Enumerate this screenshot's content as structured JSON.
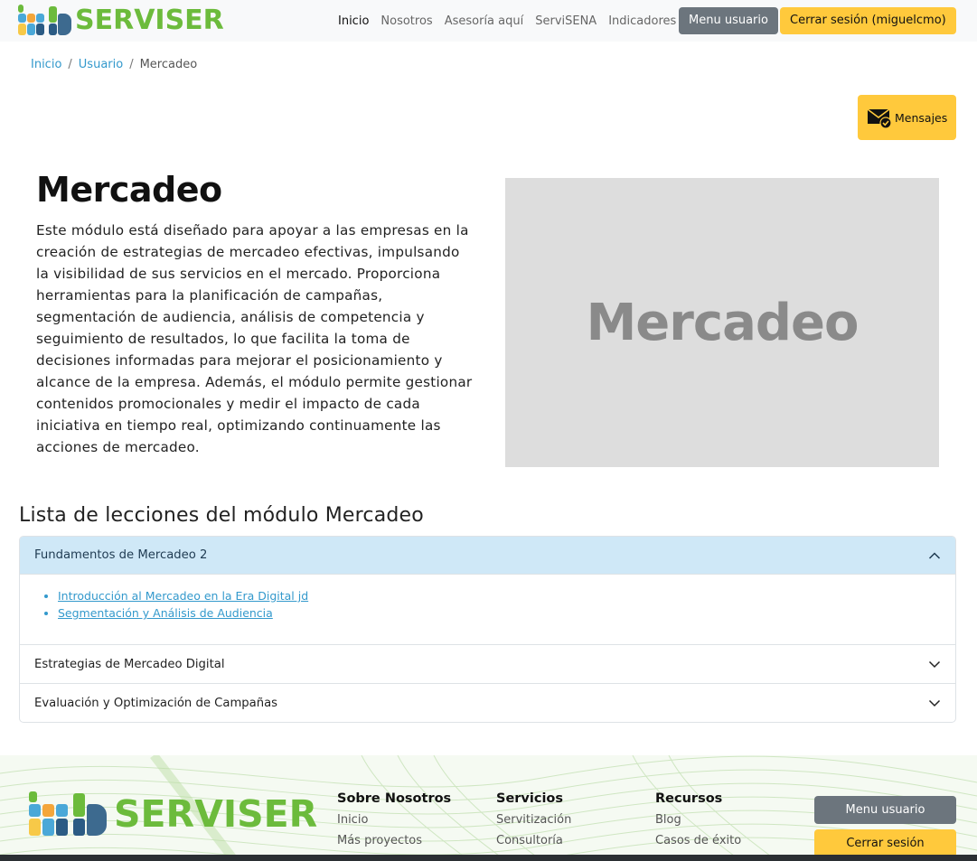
{
  "navbar": {
    "brand": "SERVISER",
    "links": [
      "Inicio",
      "Nosotros",
      "Asesoría aquí",
      "ServiSENA",
      "Indicadores"
    ],
    "menu_button": "Menu usuario",
    "logout_button": "Cerrar sesión (miguelcmo)"
  },
  "breadcrumb": {
    "items": [
      "Inicio",
      "Usuario",
      "Mercadeo"
    ],
    "separator": "/"
  },
  "messages_button": "Mensajes",
  "module": {
    "title": "Mercadeo",
    "description": "Este módulo está diseñado para apoyar a las empresas en la creación de estrategias de mercadeo efectivas, impulsando la visibilidad de sus servicios en el mercado. Proporciona herramientas para la planificación de campañas, segmentación de audiencia, análisis de competencia y seguimiento de resultados, lo que facilita la toma de decisiones informadas para mejorar el posicionamiento y alcance de la empresa. Además, el módulo permite gestionar contenidos promocionales y medir el impacto de cada iniciativa en tiempo real, optimizando continuamente las acciones de mercadeo.",
    "image_placeholder_text": "Mercadeo"
  },
  "lessons": {
    "heading": "Lista de lecciones del módulo Mercadeo",
    "sections": [
      {
        "title": "Fundamentos de Mercadeo 2",
        "expanded": true,
        "items": [
          "Introducción al Mercadeo en la Era Digital jd",
          "Segmentación y Análisis de Audiencia"
        ]
      },
      {
        "title": "Estrategias de Mercadeo Digital",
        "expanded": false
      },
      {
        "title": "Evaluación y Optimización de Campañas",
        "expanded": false
      }
    ]
  },
  "footer": {
    "brand": "SERVISER",
    "columns": [
      {
        "heading": "Sobre Nosotros",
        "links": [
          "Inicio",
          "Más proyectos"
        ]
      },
      {
        "heading": "Servicios",
        "links": [
          "Servitización",
          "Consultoría"
        ]
      },
      {
        "heading": "Recursos",
        "links": [
          "Blog",
          "Casos de éxito"
        ]
      }
    ],
    "menu_button": "Menu usuario",
    "logout_button": "Cerrar sesión"
  },
  "colors": {
    "brand_green": "#6cbb3c",
    "accent_yellow": "#ffc93c",
    "button_gray": "#6c757d",
    "link_blue": "#3399cc",
    "accordion_active_bg": "#cfe8f7",
    "placeholder_bg": "#dddddd"
  }
}
